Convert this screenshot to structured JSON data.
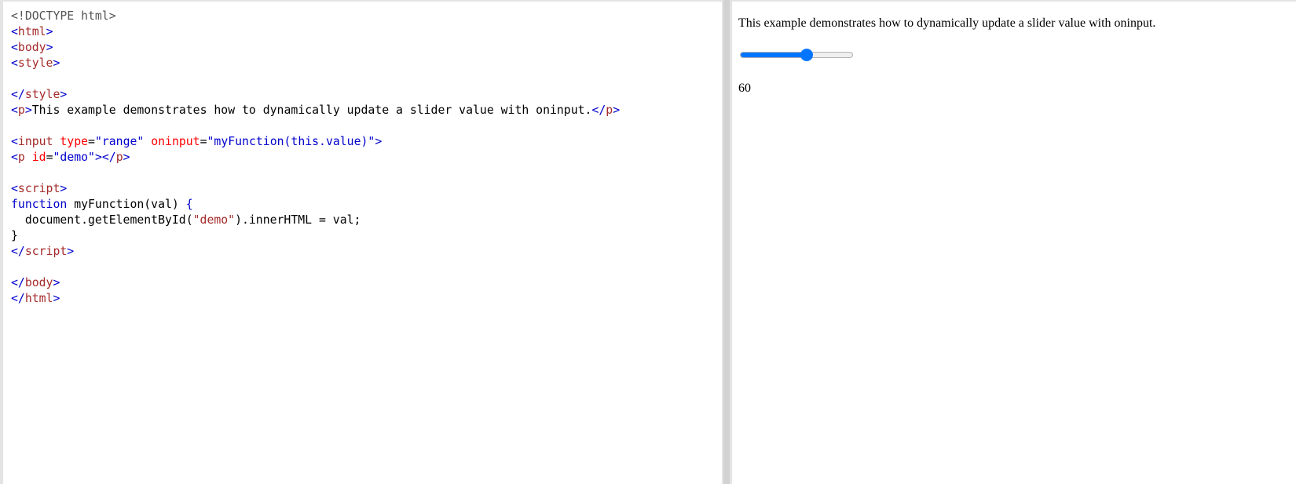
{
  "editor": {
    "lines": [
      [
        {
          "t": "<!DOCTYPE html>",
          "c": "doctype"
        }
      ],
      [
        {
          "t": "<",
          "c": "bracket"
        },
        {
          "t": "html",
          "c": "tag"
        },
        {
          "t": ">",
          "c": "bracket"
        }
      ],
      [
        {
          "t": "<",
          "c": "bracket"
        },
        {
          "t": "body",
          "c": "tag"
        },
        {
          "t": ">",
          "c": "bracket"
        }
      ],
      [
        {
          "t": "<",
          "c": "bracket"
        },
        {
          "t": "style",
          "c": "tag"
        },
        {
          "t": ">",
          "c": "bracket"
        }
      ],
      [],
      [
        {
          "t": "</",
          "c": "bracket"
        },
        {
          "t": "style",
          "c": "tag"
        },
        {
          "t": ">",
          "c": "bracket"
        }
      ],
      [
        {
          "t": "<",
          "c": "bracket"
        },
        {
          "t": "p",
          "c": "tag"
        },
        {
          "t": ">",
          "c": "bracket"
        },
        {
          "t": "This example demonstrates how to dynamically update a slider value with oninput.",
          "c": "plain"
        },
        {
          "t": "</",
          "c": "bracket"
        },
        {
          "t": "p",
          "c": "tag"
        },
        {
          "t": ">",
          "c": "bracket"
        }
      ],
      [],
      [
        {
          "t": "<",
          "c": "bracket"
        },
        {
          "t": "input",
          "c": "tag"
        },
        {
          "t": " ",
          "c": "plain"
        },
        {
          "t": "type",
          "c": "attr"
        },
        {
          "t": "=",
          "c": "plain"
        },
        {
          "t": "\"range\"",
          "c": "value"
        },
        {
          "t": " ",
          "c": "plain"
        },
        {
          "t": "oninput",
          "c": "attr"
        },
        {
          "t": "=",
          "c": "plain"
        },
        {
          "t": "\"myFunction(this.value)\"",
          "c": "value"
        },
        {
          "t": ">",
          "c": "bracket"
        }
      ],
      [
        {
          "t": "<",
          "c": "bracket"
        },
        {
          "t": "p",
          "c": "tag"
        },
        {
          "t": " ",
          "c": "plain"
        },
        {
          "t": "id",
          "c": "attr"
        },
        {
          "t": "=",
          "c": "plain"
        },
        {
          "t": "\"demo\"",
          "c": "value"
        },
        {
          "t": "></",
          "c": "bracket"
        },
        {
          "t": "p",
          "c": "tag"
        },
        {
          "t": ">",
          "c": "bracket"
        }
      ],
      [],
      [
        {
          "t": "<",
          "c": "bracket"
        },
        {
          "t": "script",
          "c": "tag"
        },
        {
          "t": ">",
          "c": "bracket"
        }
      ],
      [
        {
          "t": "function",
          "c": "keyword"
        },
        {
          "t": " myFunction(val) ",
          "c": "plain"
        },
        {
          "t": "{",
          "c": "keyword"
        }
      ],
      [
        {
          "t": "  document.getElementById(",
          "c": "plain"
        },
        {
          "t": "\"demo\"",
          "c": "string"
        },
        {
          "t": ").innerHTML = val;",
          "c": "plain"
        }
      ],
      [
        {
          "t": "}",
          "c": "plain"
        }
      ],
      [
        {
          "t": "</",
          "c": "bracket"
        },
        {
          "t": "script",
          "c": "tag"
        },
        {
          "t": ">",
          "c": "bracket"
        }
      ],
      [],
      [
        {
          "t": "</",
          "c": "bracket"
        },
        {
          "t": "body",
          "c": "tag"
        },
        {
          "t": ">",
          "c": "bracket"
        }
      ],
      [
        {
          "t": "</",
          "c": "bracket"
        },
        {
          "t": "html",
          "c": "tag"
        },
        {
          "t": ">",
          "c": "bracket"
        }
      ]
    ]
  },
  "preview": {
    "paragraph": "This example demonstrates how to dynamically update a slider value with oninput.",
    "slider": {
      "value": 60,
      "min": 0,
      "max": 100
    },
    "result_text": "60"
  },
  "colors": {
    "slider_accent": "#0075ff",
    "tag": "#a52a2a",
    "bracket": "#0000cd",
    "attribute": "#ff0000"
  }
}
